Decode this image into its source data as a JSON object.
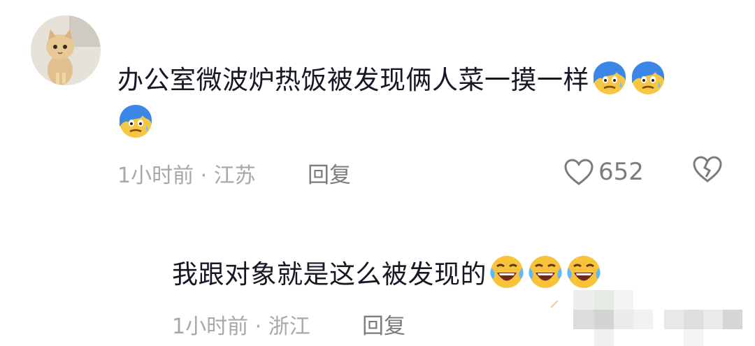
{
  "comment": {
    "text": "办公室微波炉热饭被发现俩人菜一摸一样",
    "emojis": [
      "blue-sweat-emoji",
      "blue-sweat-emoji",
      "blue-sweat-emoji"
    ],
    "time": "1小时前",
    "sep": "·",
    "location": "江苏",
    "reply_label": "回复",
    "likes": "652"
  },
  "reply": {
    "text": "我跟对象就是这么被发现的",
    "emojis": [
      "laugh-cry-emoji",
      "laugh-cry-emoji",
      "laugh-cry-emoji"
    ],
    "time": "1小时前",
    "sep": "·",
    "location": "浙江",
    "reply_label": "回复"
  },
  "colors": {
    "meta": "#a7a7ad",
    "text": "#161823",
    "action": "#7b7b80"
  }
}
